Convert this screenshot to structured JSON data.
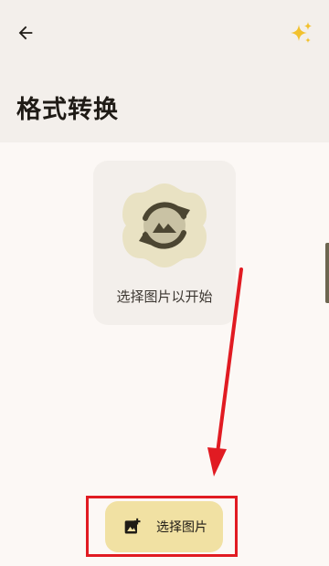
{
  "header": {
    "title": "格式转换",
    "back_icon": "arrow-left-icon",
    "action_icon": "sparkles-icon"
  },
  "empty_state": {
    "icon": "image-sync-icon",
    "text": "选择图片以开始"
  },
  "fab": {
    "icon": "add-photo-icon",
    "label": "选择图片"
  },
  "annotation": {
    "color": "#e11b22"
  },
  "colors": {
    "background": "#fcf8f5",
    "surface": "#f3efeb",
    "badge": "#e9e2c3",
    "icon_dark": "#4c4632",
    "fab": "#f1e1a3",
    "sparkle": "#f2c12e"
  }
}
